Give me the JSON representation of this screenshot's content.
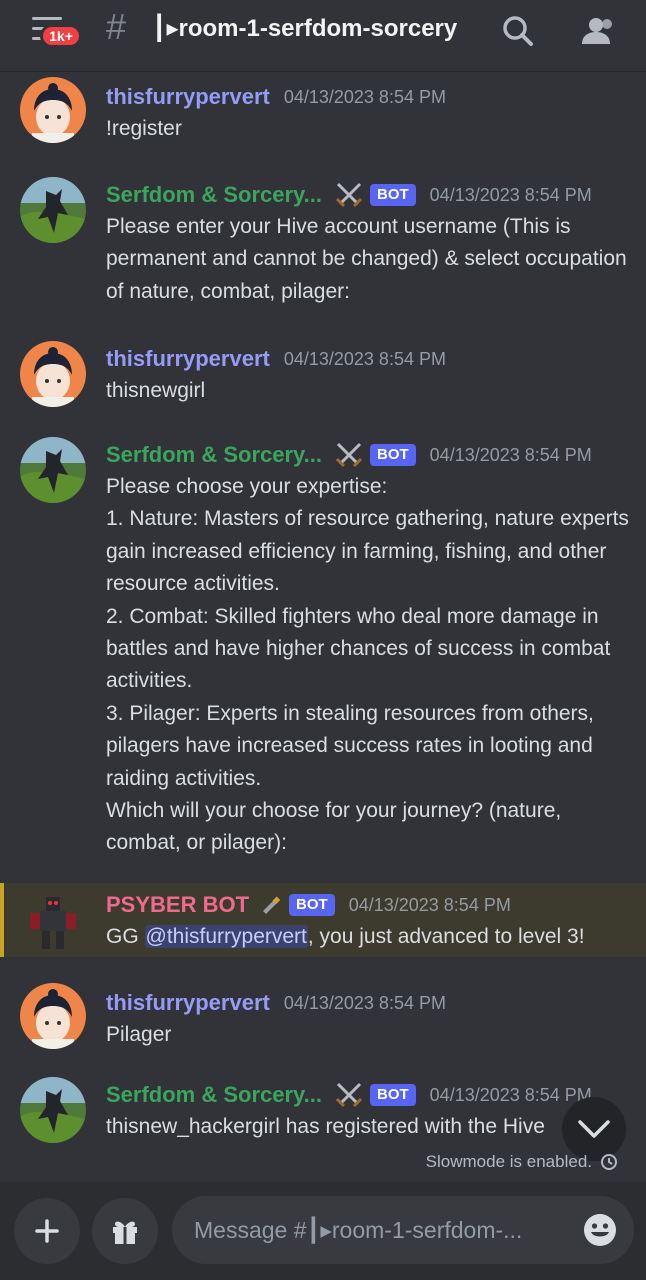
{
  "header": {
    "notification_count": "1k+",
    "hash": "#",
    "channel_name": "┃▸room-1-serfdom-sorcery",
    "icons": [
      "menu-icon",
      "search-icon",
      "members-icon"
    ]
  },
  "messages": [
    {
      "author": "thisfurrypervert",
      "timestamp": "04/13/2023 8:54 PM",
      "text": "!register"
    },
    {
      "author": "Serfdom & Sorcery...",
      "tag": "BOT",
      "timestamp": "04/13/2023 8:54 PM",
      "text": "Please enter your Hive account username (This is permanent and cannot be changed) & select occupation of nature, combat, pilager:"
    },
    {
      "author": "thisfurrypervert",
      "timestamp": "04/13/2023 8:54 PM",
      "text": "thisnewgirl"
    },
    {
      "author": "Serfdom & Sorcery...",
      "tag": "BOT",
      "timestamp": "04/13/2023 8:54 PM",
      "text": "Please choose your expertise:\n1. Nature: Masters of resource gathering, nature experts gain increased efficiency in farming, fishing, and other resource activities.\n2. Combat: Skilled fighters who deal more damage in battles and have higher chances of success in combat activities.\n3. Pilager: Experts in stealing resources from others, pilagers have increased success rates in looting and raiding activities.\nWhich will your choose for your journey? (nature, combat, or pilager):"
    },
    {
      "author": "PSYBER BOT",
      "tag": "BOT",
      "timestamp": "04/13/2023 8:54 PM",
      "text_before": "GG ",
      "mention": "@thisfurrypervert",
      "text_after": ", you just advanced to level 3!"
    },
    {
      "author": "thisfurrypervert",
      "timestamp": "04/13/2023 8:54 PM",
      "text": "Pilager"
    },
    {
      "author": "Serfdom & Sorcery...",
      "tag": "BOT",
      "timestamp": "04/13/2023 8:54 PM",
      "text": "thisnew_hackergirl has registered with the Hive"
    }
  ],
  "slowmode": "Slowmode is enabled.",
  "composer": {
    "placeholder": "Message #┃▸room-1-serfdom-..."
  },
  "colors": {
    "background": "#313338",
    "user_name": "#949cf7",
    "bot_name": "#3ba55d",
    "psyber_name": "#f06a8f",
    "bot_tag": "#5865f2",
    "mention_bg": "#3c4270"
  }
}
